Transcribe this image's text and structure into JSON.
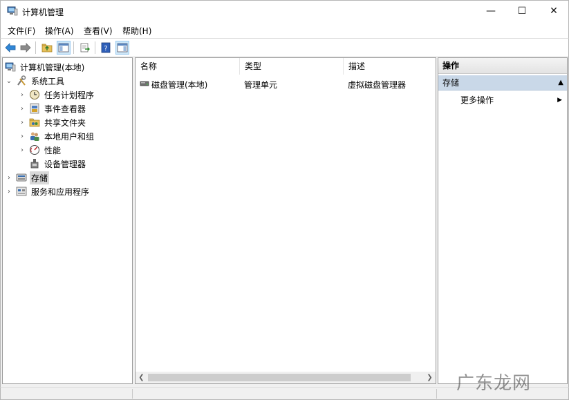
{
  "window": {
    "title": "计算机管理",
    "minimize_glyph": "—",
    "maximize_glyph": "☐",
    "close_glyph": "✕"
  },
  "menu": {
    "file": "文件(F)",
    "action": "操作(A)",
    "view": "查看(V)",
    "help": "帮助(H)"
  },
  "tree": {
    "root": "计算机管理(本地)",
    "system_tools": "系统工具",
    "task_scheduler": "任务计划程序",
    "event_viewer": "事件查看器",
    "shared_folders": "共享文件夹",
    "local_users": "本地用户和组",
    "performance": "性能",
    "device_manager": "设备管理器",
    "storage": "存储",
    "services_apps": "服务和应用程序"
  },
  "list": {
    "columns": [
      "名称",
      "类型",
      "描述"
    ],
    "rows": [
      {
        "name": "磁盘管理(本地)",
        "type": "管理单元",
        "description": "虚拟磁盘管理器"
      }
    ]
  },
  "actions": {
    "header": "操作",
    "section": "存储",
    "more_actions": "更多操作"
  },
  "watermark": "广东龙网",
  "colors": {
    "accent_selection": "#c9d8e8",
    "tree_selection": "#d9d9d9",
    "toolbar_pressed": "#cde6f7"
  }
}
